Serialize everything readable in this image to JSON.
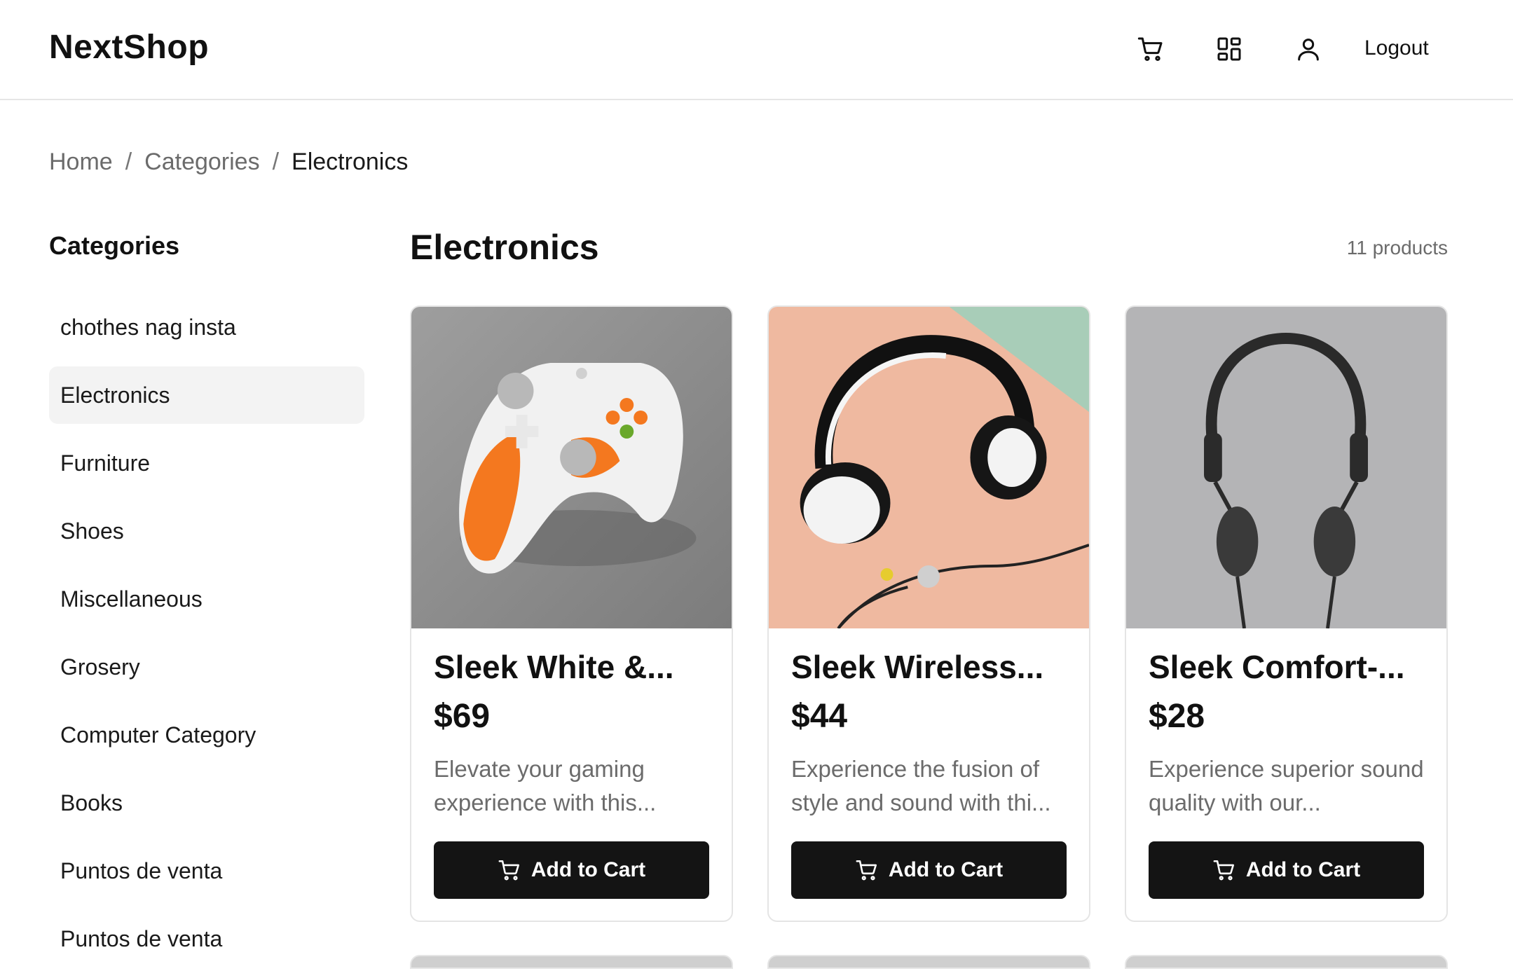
{
  "header": {
    "brand": "NextShop",
    "icons": [
      "cart-icon",
      "grid-icon",
      "user-icon"
    ],
    "logout_label": "Logout"
  },
  "breadcrumb": {
    "items": [
      "Home",
      "Categories",
      "Electronics"
    ],
    "separator": "/"
  },
  "sidebar": {
    "title": "Categories",
    "items": [
      {
        "label": "chothes nag insta",
        "active": false
      },
      {
        "label": "Electronics",
        "active": true
      },
      {
        "label": "Furniture",
        "active": false
      },
      {
        "label": "Shoes",
        "active": false
      },
      {
        "label": "Miscellaneous",
        "active": false
      },
      {
        "label": "Grosery",
        "active": false
      },
      {
        "label": "Computer Category",
        "active": false
      },
      {
        "label": "Books",
        "active": false
      },
      {
        "label": "Puntos de venta",
        "active": false
      },
      {
        "label": "Puntos de venta",
        "active": false
      }
    ]
  },
  "main": {
    "title": "Electronics",
    "count": "11 products",
    "products": [
      {
        "name": "Sleek White &...",
        "price": "$69",
        "desc": "Elevate your gaming experience with this...",
        "button": "Add to Cart",
        "image": "game-controller-image"
      },
      {
        "name": "Sleek Wireless...",
        "price": "$44",
        "desc": "Experience the fusion of style and sound with thi...",
        "button": "Add to Cart",
        "image": "wireless-headphones-image"
      },
      {
        "name": "Sleek Comfort-...",
        "price": "$28",
        "desc": "Experience superior sound quality with our...",
        "button": "Add to Cart",
        "image": "black-headphones-image"
      }
    ]
  },
  "colors": {
    "button_bg": "#141414",
    "active_category_bg": "#f3f3f3",
    "muted_text": "#6b6b6b"
  }
}
